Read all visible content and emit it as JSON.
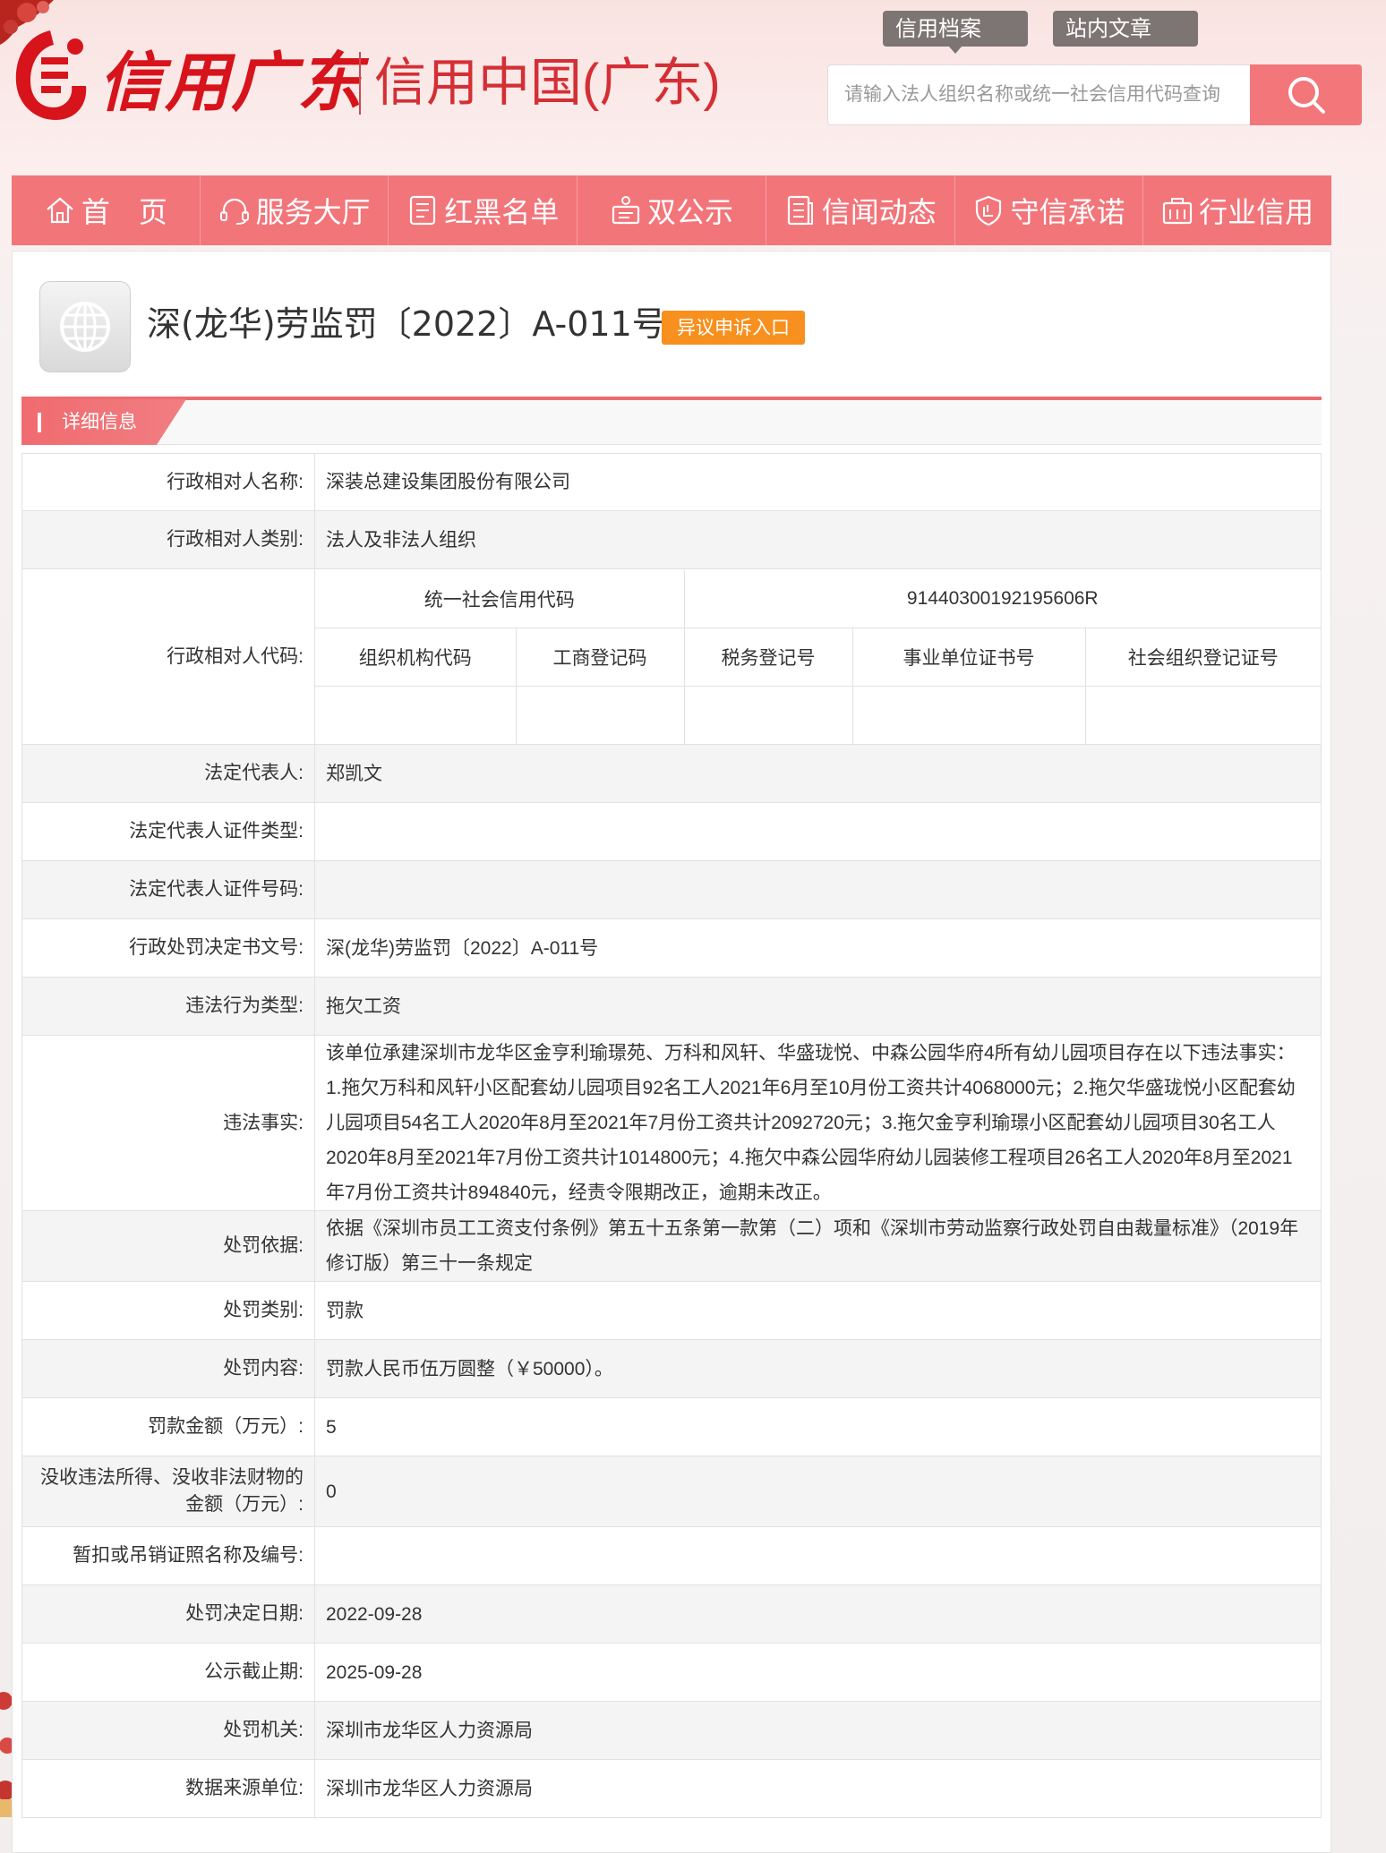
{
  "header": {
    "logo_script": "信用广东",
    "logo_subtitle": "信用中国(广东)",
    "top_tabs": [
      "信用档案",
      "站内文章"
    ],
    "search": {
      "placeholder": "请输入法人组织名称或统一社会信用代码查询",
      "value": ""
    }
  },
  "nav": {
    "items": [
      {
        "label": "首　页",
        "icon": "home-icon"
      },
      {
        "label": "服务大厅",
        "icon": "headset-icon"
      },
      {
        "label": "红黑名单",
        "icon": "list-icon"
      },
      {
        "label": "双公示",
        "icon": "presenter-icon"
      },
      {
        "label": "信闻动态",
        "icon": "news-icon"
      },
      {
        "label": "守信承诺",
        "icon": "shield-icon"
      },
      {
        "label": "行业信用",
        "icon": "briefcase-icon"
      }
    ]
  },
  "record": {
    "title": "深(龙华)劳监罚〔2022〕A-011号",
    "objection_button": "异议申诉入口",
    "section_title": "详细信息"
  },
  "details": {
    "party_name_label": "行政相对人名称:",
    "party_name": "深装总建设集团股份有限公司",
    "party_type_label": "行政相对人类别:",
    "party_type": "法人及非法人组织",
    "party_code_label": "行政相对人代码:",
    "codes": {
      "uscc_label": "统一社会信用代码",
      "uscc_value": "91440300192195606R",
      "headers": [
        "组织机构代码",
        "工商登记码",
        "税务登记号",
        "事业单位证书号",
        "社会组织登记证号"
      ],
      "values": [
        "",
        "",
        "",
        "",
        ""
      ]
    },
    "legal_rep_label": "法定代表人:",
    "legal_rep": "郑凯文",
    "legal_rep_id_type_label": "法定代表人证件类型:",
    "legal_rep_id_type": "",
    "legal_rep_id_no_label": "法定代表人证件号码:",
    "legal_rep_id_no": "",
    "decision_no_label": "行政处罚决定书文号:",
    "decision_no": "深(龙华)劳监罚〔2022〕A-011号",
    "violation_type_label": "违法行为类型:",
    "violation_type": "拖欠工资",
    "violation_facts_label": "违法事实:",
    "violation_facts": "该单位承建深圳市龙华区金亨利瑜璟苑、万科和风轩、华盛珑悦、中森公园华府4所有幼儿园项目存在以下违法事实：1.拖欠万科和风轩小区配套幼儿园项目92名工人2021年6月至10月份工资共计4068000元；2.拖欠华盛珑悦小区配套幼儿园项目54名工人2020年8月至2021年7月份工资共计2092720元；3.拖欠金亨利瑜璟小区配套幼儿园项目30名工人2020年8月至2021年7月份工资共计1014800元；4.拖欠中森公园华府幼儿园装修工程项目26名工人2020年8月至2021年7月份工资共计894840元，经责令限期改正，逾期未改正。",
    "basis_label": "处罚依据:",
    "basis": "依据《深圳市员工工资支付条例》第五十五条第一款第（二）项和《深圳市劳动监察行政处罚自由裁量标准》（2019年修订版）第三十一条规定",
    "penalty_category_label": "处罚类别:",
    "penalty_category": "罚款",
    "penalty_content_label": "处罚内容:",
    "penalty_content": "罚款人民币伍万圆整（￥50000）。",
    "fine_amount_label": "罚款金额（万元）:",
    "fine_amount": "5",
    "confiscation_label": "没收违法所得、没收非法财物的金额（万元）:",
    "confiscation_amount": "0",
    "license_label": "暂扣或吊销证照名称及编号:",
    "license": "",
    "decision_date_label": "处罚决定日期:",
    "decision_date": "2022-09-28",
    "publicity_end_label": "公示截止期:",
    "publicity_end": "2025-09-28",
    "authority_label": "处罚机关:",
    "authority": "深圳市龙华区人力资源局",
    "data_source_label": "数据来源单位:",
    "data_source": "深圳市龙华区人力资源局"
  },
  "colors": {
    "brand_red": "#d7131b",
    "nav_bg": "#f2757a",
    "search_btn": "#f2767a",
    "objection_orange": "#f7901e",
    "tab_gray": "#7d7573"
  }
}
